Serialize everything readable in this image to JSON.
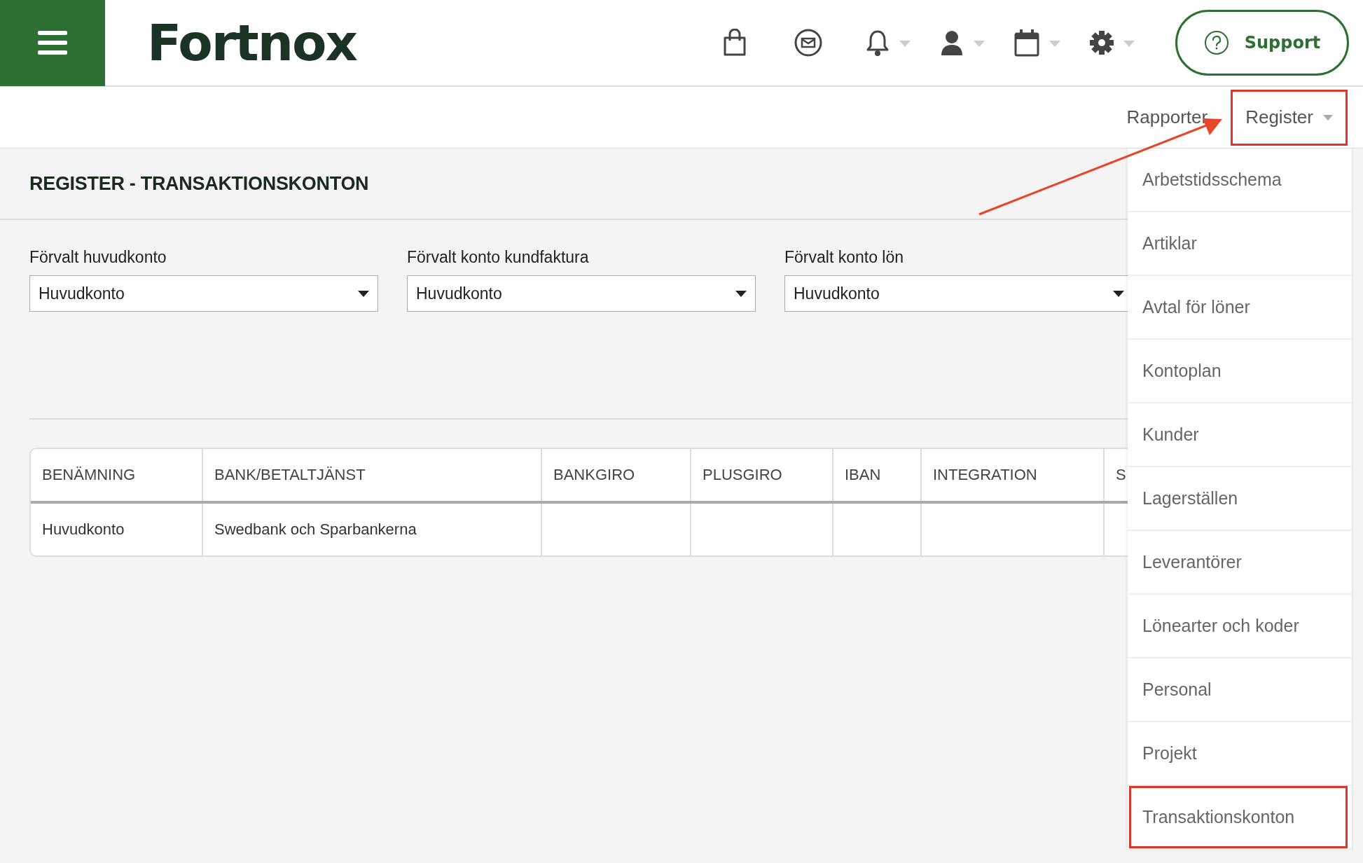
{
  "header": {
    "logo": "Fortnox",
    "icons": [
      {
        "kind": "bag",
        "menu": false
      },
      {
        "kind": "mail",
        "menu": false
      },
      {
        "kind": "bell",
        "menu": true
      },
      {
        "kind": "person",
        "menu": true
      },
      {
        "kind": "calendar",
        "menu": true
      },
      {
        "kind": "gear",
        "menu": true
      }
    ],
    "support": "Support"
  },
  "nav": [
    {
      "label": "Rapporter",
      "menu": false,
      "annotated": false
    },
    {
      "label": "Register",
      "menu": true,
      "annotated": true
    }
  ],
  "page_title": "REGISTER - TRANSAKTIONSKONTON",
  "selects": [
    {
      "label": "Förvalt huvudkonto",
      "value": "Huvudkonto"
    },
    {
      "label": "Förvalt konto kundfaktura",
      "value": "Huvudkonto"
    },
    {
      "label": "Förvalt konto lön",
      "value": "Huvudkonto"
    }
  ],
  "table": {
    "columns": [
      "BENÄMNING",
      "BANK/BETALTJÄNST",
      "BANKGIRO",
      "PLUSGIRO",
      "IBAN",
      "INTEGRATION",
      "S"
    ],
    "rows": [
      [
        "Huvudkonto",
        "Swedbank och Sparbankerna",
        "",
        "",
        "",
        "",
        ""
      ]
    ]
  },
  "dropdown": [
    {
      "label": "Arbetstidsschema",
      "annotated": false
    },
    {
      "label": "Artiklar",
      "annotated": false
    },
    {
      "label": "Avtal för löner",
      "annotated": false
    },
    {
      "label": "Kontoplan",
      "annotated": false
    },
    {
      "label": "Kunder",
      "annotated": false
    },
    {
      "label": "Lagerställen",
      "annotated": false
    },
    {
      "label": "Leverantörer",
      "annotated": false
    },
    {
      "label": "Lönearter och koder",
      "annotated": false
    },
    {
      "label": "Personal",
      "annotated": false
    },
    {
      "label": "Projekt",
      "annotated": false
    },
    {
      "label": "Transaktionskonton",
      "annotated": true
    }
  ]
}
